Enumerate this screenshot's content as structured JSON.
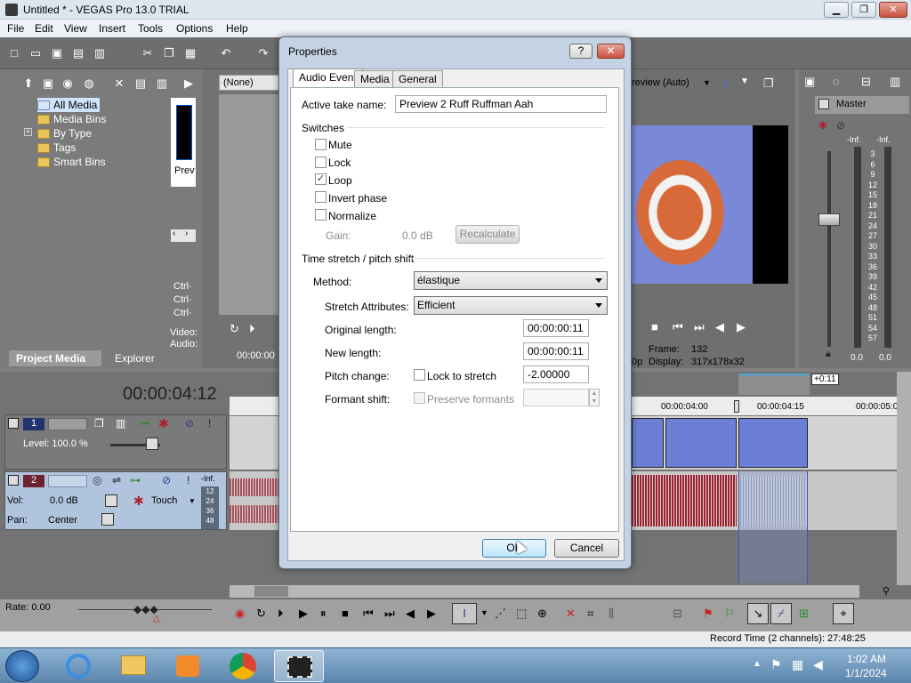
{
  "window": {
    "title": "Untitled * - VEGAS Pro 13.0 TRIAL",
    "controls": {
      "minimize": "▁",
      "maximize": "❐",
      "close": "✕"
    }
  },
  "menu": [
    "File",
    "Edit",
    "View",
    "Insert",
    "Tools",
    "Options",
    "Help"
  ],
  "project_media": {
    "tree": [
      "All Media",
      "Media Bins",
      "By Type",
      "Tags",
      "Smart Bins"
    ],
    "expander": "+",
    "tabs": [
      "Project Media",
      "Explorer"
    ],
    "trimmer_label": "Prev",
    "nav_arrows": [
      "‹",
      "›"
    ]
  },
  "trimmer": {
    "dropdown": "(None)",
    "timecode": "00:00:00",
    "ctrl_labels": [
      "Ctrl·",
      "Ctrl·",
      "Ctrl·"
    ],
    "video_label": "Video:",
    "audio_label": "Audio:"
  },
  "preview": {
    "mode": "review (Auto)",
    "frame_label": "Frame:",
    "frame_value": "132",
    "display_label": "Display:",
    "display_value": "317x178x32",
    "op_fragment": "0p"
  },
  "master": {
    "title": "Master",
    "inf_left": "-Inf.",
    "inf_right": "-Inf.",
    "scale": [
      "3",
      "6",
      "9",
      "12",
      "15",
      "18",
      "21",
      "24",
      "27",
      "30",
      "33",
      "36",
      "39",
      "42",
      "45",
      "48",
      "51",
      "54",
      "57"
    ],
    "level_left": "0.0",
    "level_right": "0.0"
  },
  "timeline": {
    "timecode": "00:00:04:12",
    "ruler": [
      "00:00:04:00",
      "00:00:04:15",
      "00:00:05:0"
    ],
    "region_label": "+0:11",
    "track1": {
      "number": "1",
      "level": "Level: 100.0 %"
    },
    "track2": {
      "number": "2",
      "vol": "Vol:",
      "vol_value": "0.0 dB",
      "pan": "Pan:",
      "pan_value": "Center",
      "touch": "Touch",
      "inf": "-Inf.",
      "meter": [
        "12",
        "24",
        "36",
        "48"
      ]
    },
    "rate": "Rate: 0.00",
    "record_time": "Record Time (2 channels): 27:48:25"
  },
  "dialog": {
    "title": "Properties",
    "help_btn": "?",
    "close_btn": "✕",
    "tabs": [
      "Audio Event",
      "Media",
      "General"
    ],
    "active_take_label": "Active take name:",
    "active_take_value": "Preview 2 Ruff Ruffman Aah",
    "switches_header": "Switches",
    "switches": [
      {
        "label": "Mute",
        "checked": false
      },
      {
        "label": "Lock",
        "checked": false
      },
      {
        "label": "Loop",
        "checked": true
      },
      {
        "label": "Invert phase",
        "checked": false
      },
      {
        "label": "Normalize",
        "checked": false
      }
    ],
    "check_mark": "✓",
    "gain_label": "Gain:",
    "gain_value": "0.0 dB",
    "recalculate": "Recalculate",
    "stretch_header": "Time stretch / pitch shift",
    "method_label": "Method:",
    "method_value": "élastique",
    "attributes_label": "Stretch Attributes:",
    "attributes_value": "Efficient",
    "original_length_label": "Original length:",
    "original_length_value": "00:00:00:11",
    "new_length_label": "New length:",
    "new_length_value": "00:00:00:11",
    "pitch_label": "Pitch change:",
    "lock_to_stretch": "Lock to stretch",
    "pitch_value": "-2.00000",
    "formant_label": "Formant shift:",
    "preserve_formants": "Preserve formants",
    "ok": "OK",
    "cancel": "Cancel"
  },
  "taskbar": {
    "time": "1:02 AM",
    "date": "1/1/2024"
  }
}
